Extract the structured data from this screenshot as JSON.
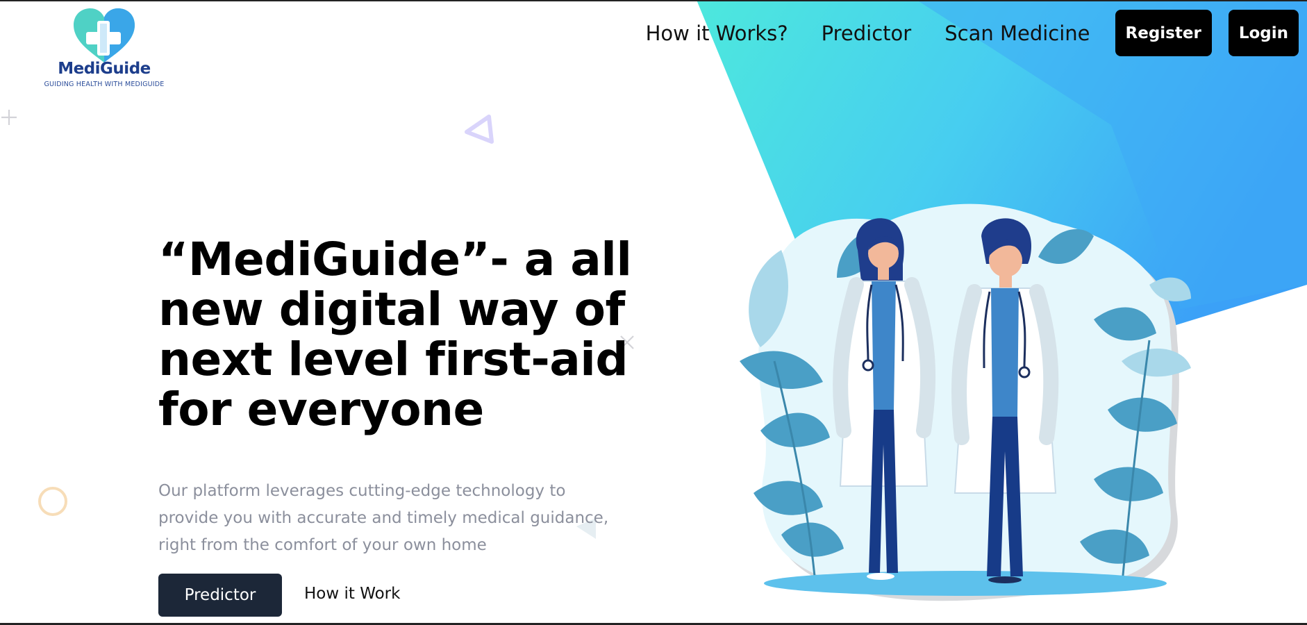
{
  "brand": {
    "name": "MediGuide",
    "tagline": "GUIDING HEALTH WITH MEDIGUIDE",
    "primary_color": "#1d3e8c",
    "heart_colors": [
      "#4fd1c5",
      "#3aa6e8"
    ]
  },
  "nav": {
    "links": [
      "How it Works?",
      "Predictor",
      "Scan Medicine"
    ],
    "register_label": "Register",
    "login_label": "Login"
  },
  "hero": {
    "title": "“MediGuide”- a all new digital way of next level first-aid for everyone",
    "subtitle": "Our platform leverages cutting-edge technology to provide you with accurate and timely medical guidance, right from the comfort of your own home",
    "primary_button": "Predictor",
    "secondary_button": "How it Work"
  },
  "illustration": {
    "icon": "two-doctors-illustration",
    "accent_colors": [
      "#45e0e0",
      "#3b9ef7",
      "#2a6fb0"
    ]
  },
  "decorations": [
    "plus-icon",
    "triangle-icon",
    "cross-icon",
    "circle-icon",
    "triangle-small-icon"
  ]
}
